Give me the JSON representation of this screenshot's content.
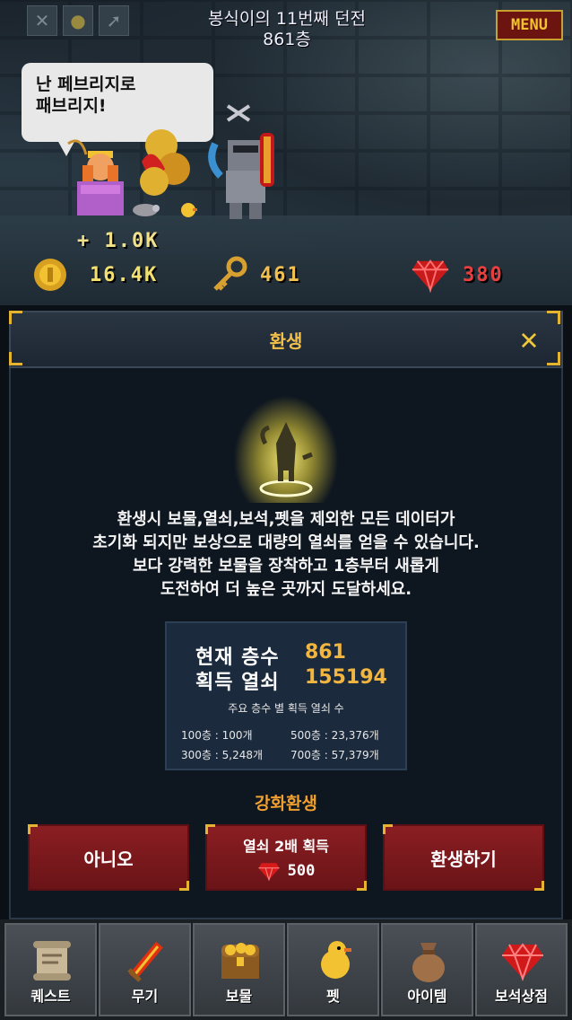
{
  "header": {
    "title_line1": "봉식이의 11번째 던전",
    "title_line2": "861층",
    "menu_label": "MENU",
    "top_icons": [
      "swords-icon",
      "coin-stack-icon",
      "boot-icon"
    ]
  },
  "scene": {
    "speech_line1": "난 페브리지로",
    "speech_line2": "패브리지!",
    "gain_text": "+ 1.0K"
  },
  "currency": {
    "coins": "16.4K",
    "keys": "461",
    "gems": "380"
  },
  "dialog": {
    "title": "환생",
    "description": [
      "환생시 보물,열쇠,보석,펫을 제외한 모든 데이터가",
      "초기화 되지만 보상으로 대량의 열쇠를 얻을 수 있습니다.",
      "보다 강력한 보물을 장착하고 1층부터 새롭게",
      "도전하여 더 높은 곳까지 도달하세요."
    ],
    "stats": {
      "floor_label": "현재 층수",
      "floor_value": "861",
      "keys_label": "획득 열쇠",
      "keys_value": "155194",
      "table_title": "주요 층수 별 획득 열쇠 수",
      "rows": [
        "100층 : 100개",
        "500층 : 23,376개",
        "300층 : 5,248개",
        "700층 : 57,379개"
      ]
    },
    "enhanced_title": "강화환생",
    "buttons": {
      "no": "아니오",
      "double_line1": "열쇠 2배 획득",
      "double_cost": "500",
      "rebirth": "환생하기"
    }
  },
  "tabs": [
    "퀘스트",
    "무기",
    "보물",
    "펫",
    "아이템",
    "보석상점"
  ],
  "colors": {
    "gold": "#f2b640",
    "panel": "#0e1620",
    "button_red": "#7a1a1e",
    "gem_red": "#e03a3a"
  }
}
